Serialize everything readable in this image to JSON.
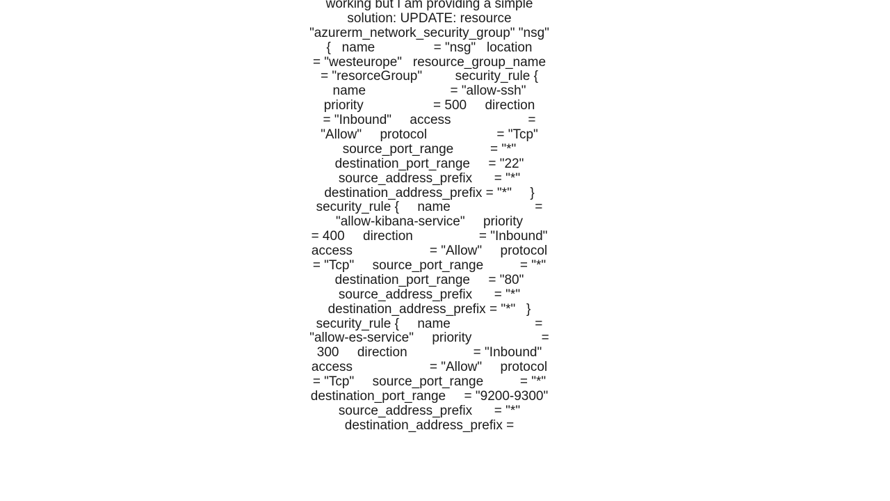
{
  "content": "working but I am providing a simple solution: UPDATE: resource \"azurerm_network_security_group\" \"nsg\" {   name                = \"nsg\"   location            = \"westeurope\"   resource_group_name = \"resorceGroup\"         security_rule {     name                       = \"allow-ssh\"     priority                   = 500     direction                  = \"Inbound\"     access                     = \"Allow\"     protocol                   = \"Tcp\"     source_port_range          = \"*\"     destination_port_range     = \"22\"     source_address_prefix      = \"*\"     destination_address_prefix = \"*\"     }   security_rule {     name                       = \"allow-kibana-service\"     priority                   = 400     direction                  = \"Inbound\"     access                     = \"Allow\"     protocol                   = \"Tcp\"     source_port_range          = \"*\"     destination_port_range     = \"80\"     source_address_prefix      = \"*\"     destination_address_prefix = \"*\"   }   security_rule {     name                       = \"allow-es-service\"     priority                   = 300     direction                  = \"Inbound\"     access                     = \"Allow\"     protocol                   = \"Tcp\"     source_port_range          = \"*\"     destination_port_range     = \"9200-9300\"     source_address_prefix      = \"*\"     destination_address_prefix ="
}
